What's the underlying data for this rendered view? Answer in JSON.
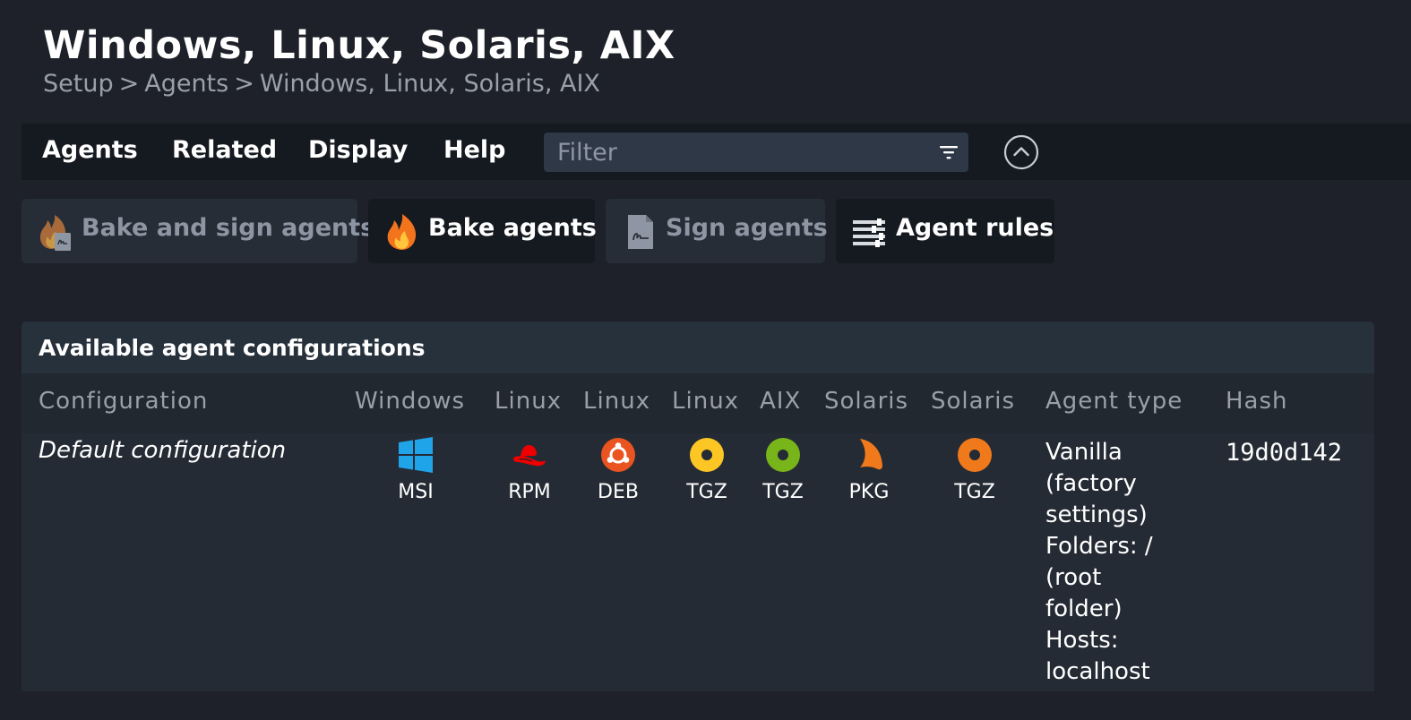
{
  "page": {
    "title": "Windows, Linux, Solaris, AIX",
    "breadcrumb": [
      "Setup",
      "Agents",
      "Windows, Linux, Solaris, AIX"
    ],
    "breadcrumb_sep": ">"
  },
  "menubar": {
    "items": [
      "Agents",
      "Related",
      "Display",
      "Help"
    ],
    "filter_placeholder": "Filter",
    "filter_icon": "filter-icon",
    "collapse_icon": "chevron-up-circle-icon"
  },
  "toolbar": {
    "buttons": [
      {
        "label": "Bake and sign agents",
        "icon": "bake-sign-icon",
        "enabled": false
      },
      {
        "label": "Bake agents",
        "icon": "flame-icon",
        "enabled": true
      },
      {
        "label": "Sign agents",
        "icon": "signature-document-icon",
        "enabled": false
      },
      {
        "label": "Agent rules",
        "icon": "rules-icon",
        "enabled": true
      }
    ]
  },
  "panel": {
    "title": "Available agent configurations",
    "columns": [
      "Configuration",
      "Windows",
      "Linux",
      "Linux",
      "Linux",
      "AIX",
      "Solaris",
      "Solaris",
      "Agent type",
      "Hash"
    ],
    "rows": [
      {
        "configuration": "Default configuration",
        "packages": [
          {
            "os": "windows",
            "icon": "windows-icon",
            "label": "MSI",
            "color": "#1fa4ea"
          },
          {
            "os": "redhat",
            "icon": "redhat-icon",
            "label": "RPM",
            "color": "#ee0000"
          },
          {
            "os": "ubuntu",
            "icon": "ubuntu-icon",
            "label": "DEB",
            "color": "#e95420"
          },
          {
            "os": "linux",
            "icon": "tgz-linux-icon",
            "label": "TGZ",
            "color": "#fcc624"
          },
          {
            "os": "aix",
            "icon": "tgz-aix-icon",
            "label": "TGZ",
            "color": "#77b51a"
          },
          {
            "os": "solaris",
            "icon": "solaris-icon",
            "label": "PKG",
            "color": "#f07a1b"
          },
          {
            "os": "solaris",
            "icon": "tgz-solaris-icon",
            "label": "TGZ",
            "color": "#f07a1b"
          }
        ],
        "agent_type_lines": [
          "Vanilla",
          "(factory",
          "settings)",
          "Folders: /",
          "(root",
          "folder)",
          "Hosts:",
          "localhost"
        ],
        "hash": "19d0d142"
      }
    ]
  },
  "colors": {
    "background": "#1e2129",
    "menubar": "#151920",
    "panel": "#252b35",
    "muted_text": "#9aa0aa"
  }
}
